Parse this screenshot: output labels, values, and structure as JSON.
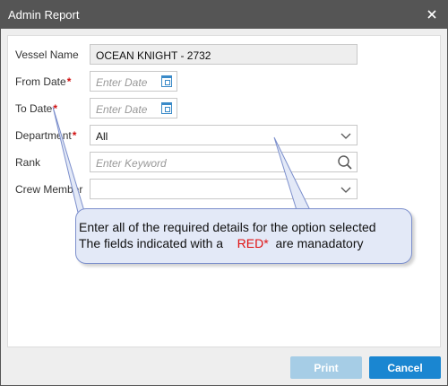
{
  "window": {
    "title": "Admin Report"
  },
  "form": {
    "vessel_name_label": "Vessel Name",
    "vessel_name_value": "OCEAN KNIGHT - 2732",
    "from_date_label": "From Date",
    "from_date_placeholder": "Enter Date",
    "to_date_label": "To Date",
    "to_date_placeholder": "Enter Date",
    "department_label": "Department",
    "department_value": "All",
    "rank_label": "Rank",
    "rank_placeholder": "Enter Keyword",
    "crew_member_label": "Crew Member",
    "crew_member_value": "",
    "required_marker": "*"
  },
  "callout": {
    "line1": "Enter all of the required details for the option selected",
    "line2_prefix": "The fields indicated with a",
    "line2_red": "RED*",
    "line2_suffix": "are manadatory"
  },
  "buttons": {
    "print": "Print",
    "cancel": "Cancel"
  },
  "colors": {
    "titlebar": "#555555",
    "accent": "#1a86d1",
    "disabled": "#a6cde6",
    "required": "#d01010",
    "callout_bg": "#e3e9f7"
  }
}
